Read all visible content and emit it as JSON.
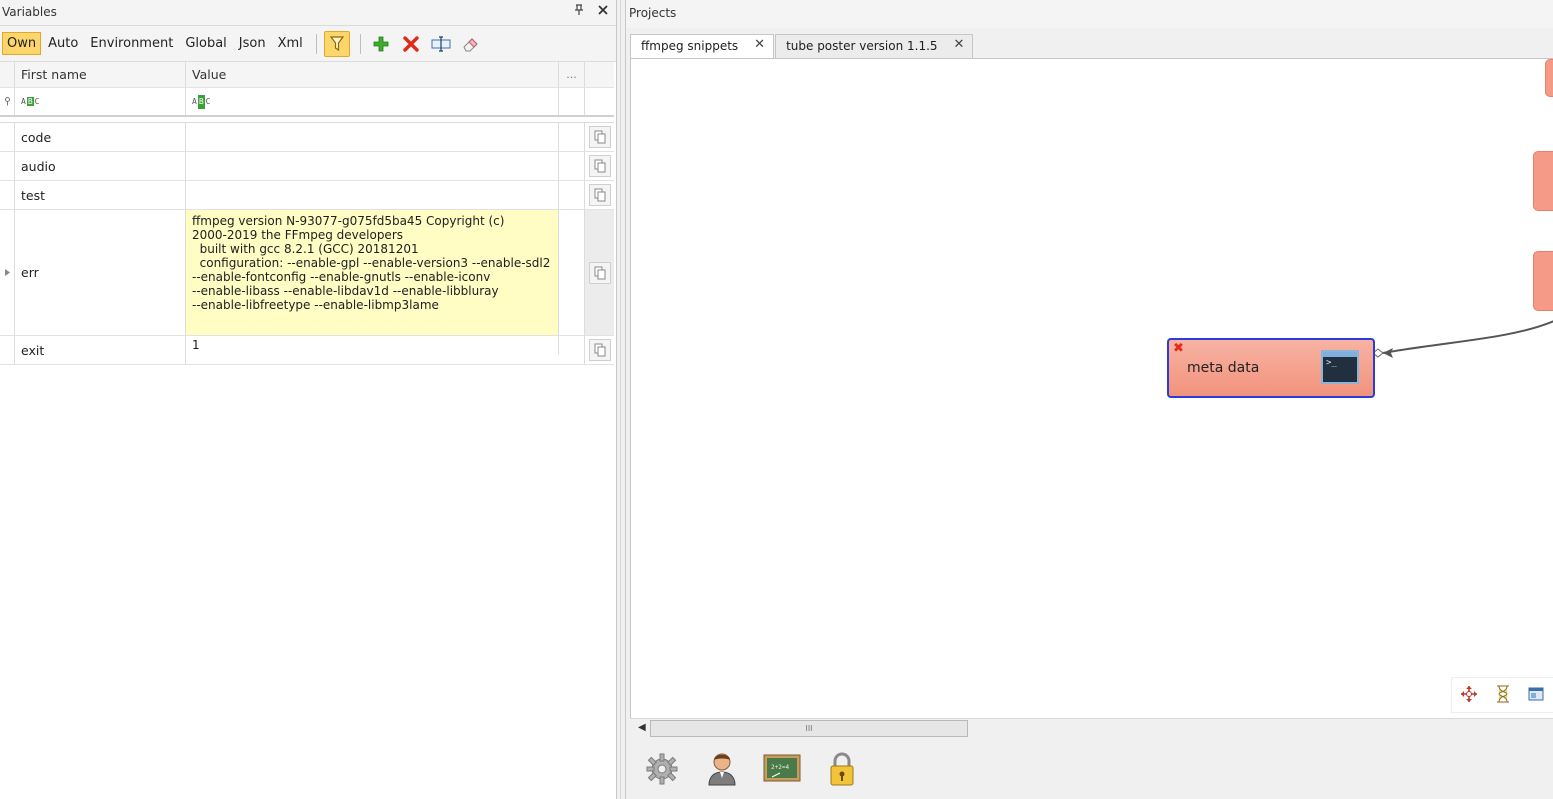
{
  "variables_panel": {
    "title": "Variables",
    "pin_icon": "pin-icon",
    "close_icon": "close-icon",
    "scopes": [
      "Own",
      "Auto",
      "Environment",
      "Global",
      "Json",
      "Xml"
    ],
    "active_scope": "Own",
    "toolbar_icons": [
      "filter-icon",
      "add-icon",
      "delete-icon",
      "rename-icon",
      "eraser-icon"
    ],
    "grid": {
      "col_name": "First name",
      "col_value": "Value",
      "col_extra": "...",
      "filter_glyph_left": "A",
      "filter_glyph_mid": "B",
      "filter_glyph_right": "C",
      "rows": [
        {
          "name": "code",
          "value": ""
        },
        {
          "name": "audio",
          "value": ""
        },
        {
          "name": "test",
          "value": ""
        },
        {
          "name": "err",
          "value": "ffmpeg version N-93077-g075fd5ba45 Copyright (c)\n2000-2019 the FFmpeg developers\n  built with gcc 8.2.1 (GCC) 20181201\n  configuration: --enable-gpl --enable-version3 --enable-sdl2\n--enable-fontconfig --enable-gnutls --enable-iconv\n--enable-libass --enable-libdav1d --enable-libbluray\n--enable-libfreetype --enable-libmp3lame"
        },
        {
          "name": "exit",
          "value": "1"
        }
      ]
    }
  },
  "projects_panel": {
    "title": "Projects",
    "tabs": [
      {
        "label": "ffmpeg snippets",
        "active": true
      },
      {
        "label": "tube poster version 1.1.5",
        "active": false
      }
    ],
    "tab_close_glyph": "✕",
    "node": {
      "label": "meta data",
      "icon": "terminal-icon",
      "border_color": "#2c3dd6",
      "fill_color": "#f4a08c"
    },
    "canvas_tools": [
      "move-icon",
      "hourglass-icon",
      "window-icon"
    ],
    "scroll_glyph": "III",
    "bottom_icons": [
      "settings-gear-icon",
      "user-icon",
      "chalkboard-icon",
      "lock-icon"
    ]
  },
  "colors": {
    "accent_yellow": "#fcd66a",
    "node_red": "#f59a86",
    "note_yellow": "#fffdc4"
  }
}
